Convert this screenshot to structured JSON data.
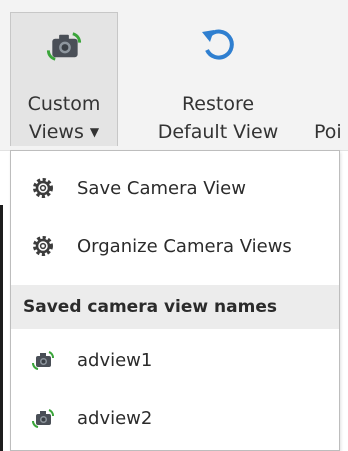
{
  "ribbon": {
    "custom_views": {
      "line1": "Custom",
      "line2": "Views",
      "caret": "▼",
      "icon": "camera-sync-icon"
    },
    "restore": {
      "line1": "Restore",
      "line2": "Default View",
      "icon": "restore-arrow-icon"
    },
    "point": {
      "label": "Poi"
    }
  },
  "menu": {
    "actions": [
      {
        "label": "Save Camera View",
        "icon": "gear-icon"
      },
      {
        "label": "Organize Camera Views",
        "icon": "gear-icon"
      }
    ],
    "saved_header": "Saved camera view names",
    "saved_views": [
      {
        "label": "adview1",
        "icon": "camera-sync-icon"
      },
      {
        "label": "adview2",
        "icon": "camera-sync-icon"
      }
    ]
  },
  "colors": {
    "ribbon_bg": "#f3f3f3",
    "pressed_bg": "#e4e4e4",
    "header_bg": "#ececec",
    "arrow_blue": "#2f7fd0",
    "camera_green": "#3aa53a"
  }
}
